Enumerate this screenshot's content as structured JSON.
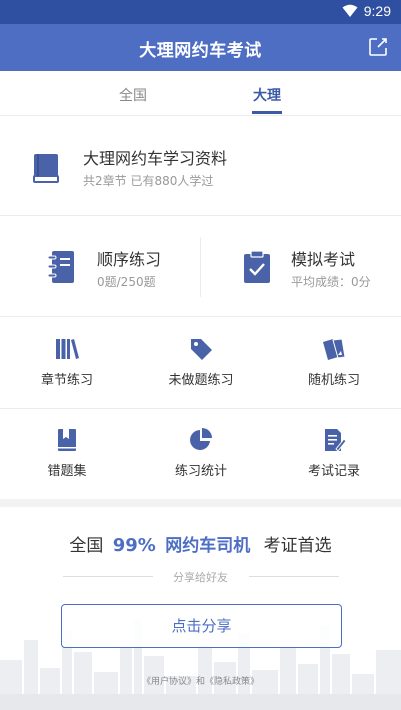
{
  "status_bar": {
    "time": "9:29"
  },
  "app_bar": {
    "title": "大理网约车考试"
  },
  "tabs": [
    {
      "label": "全国",
      "active": false
    },
    {
      "label": "大理",
      "active": true
    }
  ],
  "material": {
    "title": "大理网约车学习资料",
    "subtitle": "共2章节 已有880人学过"
  },
  "practice": {
    "sequential": {
      "title": "顺序练习",
      "subtitle": "0题/250题"
    },
    "mock_exam": {
      "title": "模拟考试",
      "subtitle": "平均成绩：0分"
    }
  },
  "grid": {
    "chapter": "章节练习",
    "undone": "未做题练习",
    "random": "随机练习",
    "wrong": "错题集",
    "stats": "练习统计",
    "records": "考试记录"
  },
  "promo": {
    "prefix": "全国",
    "percent": "99%",
    "highlight": "网约车司机",
    "suffix": "考证首选",
    "share_hint": "分享给好友",
    "share_button": "点击分享",
    "legal": "《用户协议》和《隐私政策》"
  },
  "colors": {
    "primary": "#4e6ec4",
    "status_bar": "#2f4fa0",
    "icon": "#4a63a8"
  },
  "icons": [
    "wifi-icon",
    "share-icon",
    "book-icon",
    "notebook-icon",
    "clipboard-check-icon",
    "books-icon",
    "tag-icon",
    "cards-icon",
    "bookmark-book-icon",
    "pie-chart-icon",
    "document-edit-icon"
  ]
}
